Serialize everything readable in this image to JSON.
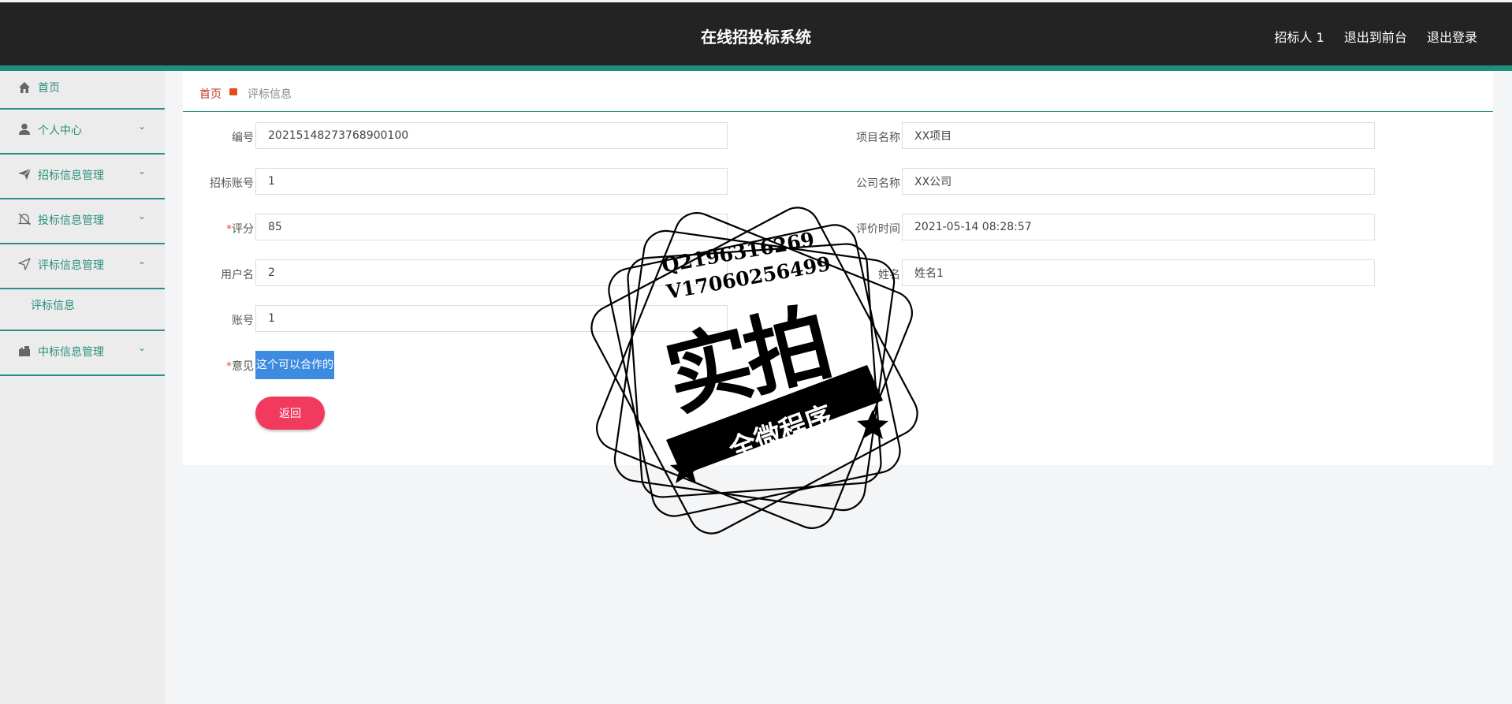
{
  "header": {
    "title": "在线招投标系统",
    "user": "招标人 1",
    "to_front": "退出到前台",
    "logout": "退出登录"
  },
  "sidebar": {
    "items": [
      {
        "label": "首页",
        "icon": "home-icon"
      },
      {
        "label": "个人中心",
        "icon": "user-icon"
      },
      {
        "label": "招标信息管理",
        "icon": "send-icon"
      },
      {
        "label": "投标信息管理",
        "icon": "bell-off-icon"
      },
      {
        "label": "评标信息管理",
        "icon": "navigation-icon",
        "expanded": true,
        "children": [
          {
            "label": "评标信息"
          }
        ]
      },
      {
        "label": "中标信息管理",
        "icon": "briefcase-icon"
      }
    ]
  },
  "breadcrumb": {
    "home": "首页",
    "current": "评标信息"
  },
  "form": {
    "bianhao": {
      "label": "编号",
      "value": "20215148273768900100"
    },
    "xiangmu": {
      "label": "项目名称",
      "value": "XX项目"
    },
    "zhaobiao_account": {
      "label": "招标账号",
      "value": "1"
    },
    "company": {
      "label": "公司名称",
      "value": "XX公司"
    },
    "score": {
      "label": "评分",
      "value": "85",
      "required": true
    },
    "eval_time": {
      "label": "评价时间",
      "value": "2021-05-14 08:28:57"
    },
    "username": {
      "label": "用户名",
      "value": "2"
    },
    "name": {
      "label": "姓名",
      "value": "姓名1"
    },
    "account": {
      "label": "账号",
      "value": "1"
    },
    "opinion": {
      "label": "意见",
      "value": "这个可以合作的",
      "required": true
    },
    "back_button": "返回"
  },
  "stamp": {
    "line1": "Q2196316269",
    "line2": "V17060256499",
    "big": "实拍",
    "banner": "全微程序"
  },
  "colors": {
    "header_bg": "#232323",
    "accent": "#1e8f7c",
    "sidebar_text": "#2b8f7d",
    "back_button": "#f23a5e",
    "selection": "#3d8be0"
  }
}
